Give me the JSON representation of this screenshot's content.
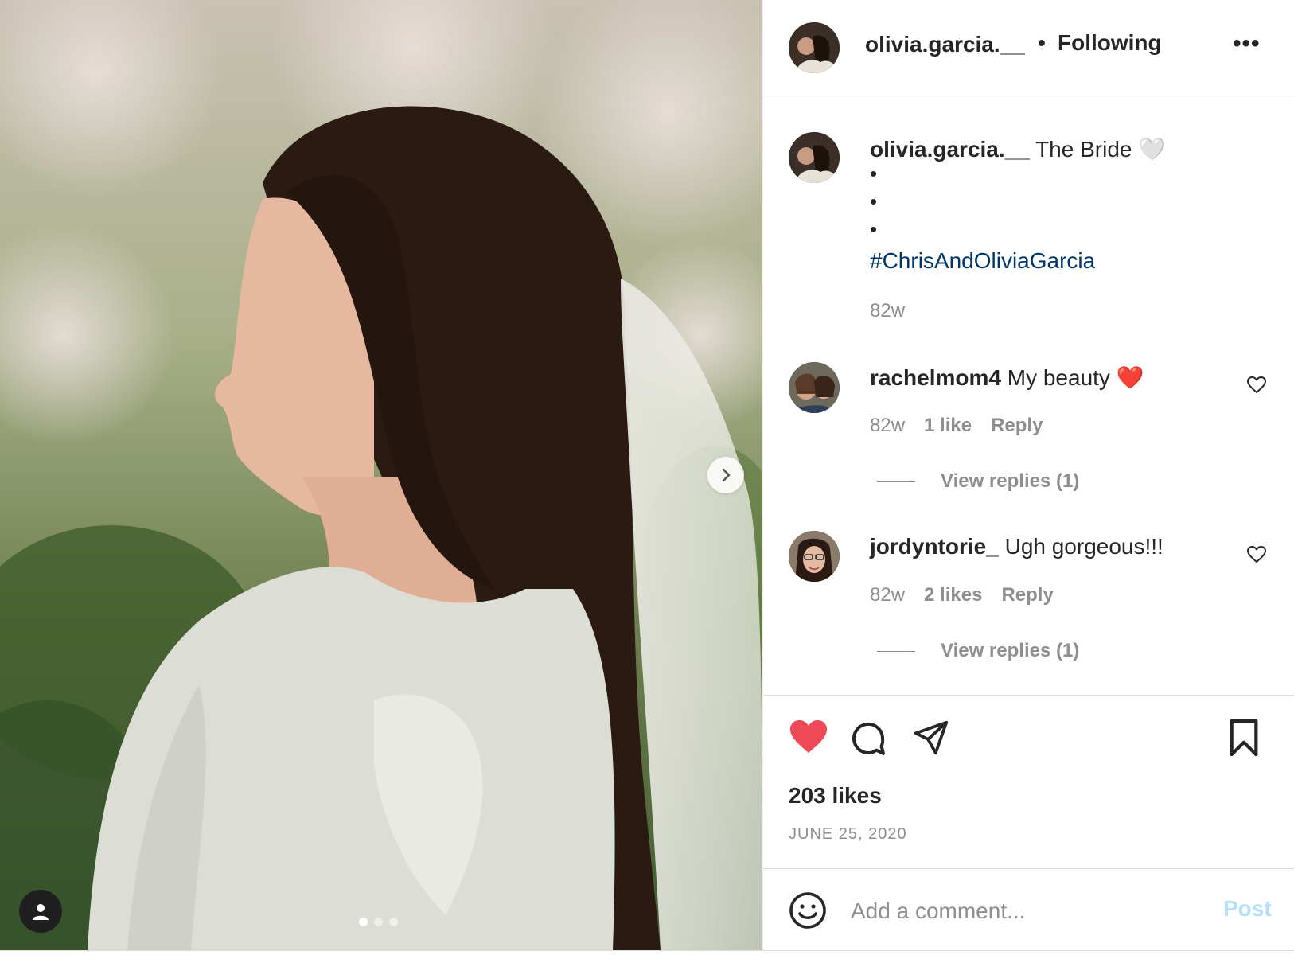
{
  "header": {
    "username": "olivia.garcia.__",
    "separator": "•",
    "follow_status": "Following",
    "more_label": "•••"
  },
  "caption": {
    "username": "olivia.garcia.__",
    "text": "The Bride",
    "emoji": "🤍",
    "bullets": [
      "•",
      "•",
      "•"
    ],
    "hashtag": "#ChrisAndOliviaGarcia",
    "time": "82w"
  },
  "comments": [
    {
      "username": "rachelmom4",
      "text": "My beauty",
      "emoji": "❤️",
      "time": "82w",
      "likes": "1 like",
      "reply": "Reply",
      "view_replies": "View replies (1)"
    },
    {
      "username": "jordyntorie_",
      "text": "Ugh gorgeous!!!",
      "time": "82w",
      "likes": "2 likes",
      "reply": "Reply",
      "view_replies": "View replies (1)"
    }
  ],
  "actions": {
    "liked": true,
    "like_color": "#ed4956",
    "likes_count": "203 likes",
    "date": "JUNE 25, 2020"
  },
  "comment_box": {
    "placeholder": "Add a comment...",
    "post_label": "Post",
    "post_color": "#b2dffc"
  },
  "media": {
    "carousel_count": 3,
    "active_index": 0
  },
  "icons": {
    "next": "chevron-right-icon",
    "user_tag": "user-icon",
    "like": "heart-icon",
    "comment": "comment-icon",
    "share": "paper-plane-icon",
    "save": "bookmark-icon",
    "emoji": "smiley-icon"
  }
}
